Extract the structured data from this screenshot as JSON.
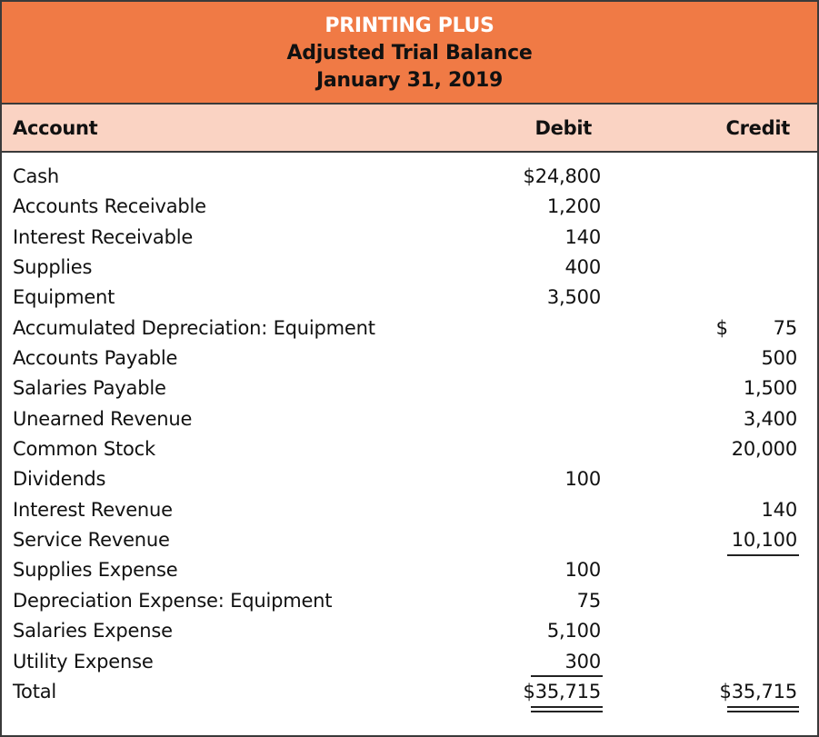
{
  "header": {
    "company": "PRINTING PLUS",
    "statement": "Adjusted Trial Balance",
    "date": "January 31, 2019"
  },
  "columns": {
    "account": "Account",
    "debit": "Debit",
    "credit": "Credit"
  },
  "colors": {
    "title_band": "#f07a45",
    "header_band": "#fad3c3",
    "border": "#3a3a3a"
  },
  "rows": [
    {
      "account": "Cash",
      "debit": "$24,800",
      "credit": ""
    },
    {
      "account": "Accounts Receivable",
      "debit": "1,200",
      "credit": ""
    },
    {
      "account": "Interest Receivable",
      "debit": "140",
      "credit": ""
    },
    {
      "account": "Supplies",
      "debit": "400",
      "credit": ""
    },
    {
      "account": "Equipment",
      "debit": "3,500",
      "credit": ""
    },
    {
      "account": "Accumulated Depreciation: Equipment",
      "debit": "",
      "credit_prefix": "$",
      "credit": "75"
    },
    {
      "account": "Accounts Payable",
      "debit": "",
      "credit": "500"
    },
    {
      "account": "Salaries Payable",
      "debit": "",
      "credit": "1,500"
    },
    {
      "account": "Unearned Revenue",
      "debit": "",
      "credit": "3,400"
    },
    {
      "account": "Common Stock",
      "debit": "",
      "credit": "20,000"
    },
    {
      "account": "Dividends",
      "debit": "100",
      "credit": ""
    },
    {
      "account": "Interest Revenue",
      "debit": "",
      "credit": "140"
    },
    {
      "account": "Service Revenue",
      "debit": "",
      "credit": "10,100"
    },
    {
      "account": "Supplies Expense",
      "debit": "100",
      "credit": ""
    },
    {
      "account": "Depreciation Expense: Equipment",
      "debit": "75",
      "credit": ""
    },
    {
      "account": "Salaries Expense",
      "debit": "5,100",
      "credit": ""
    },
    {
      "account": "Utility Expense",
      "debit": "300",
      "credit": ""
    }
  ],
  "total": {
    "label": "Total",
    "debit": "$35,715",
    "credit": "$35,715"
  }
}
